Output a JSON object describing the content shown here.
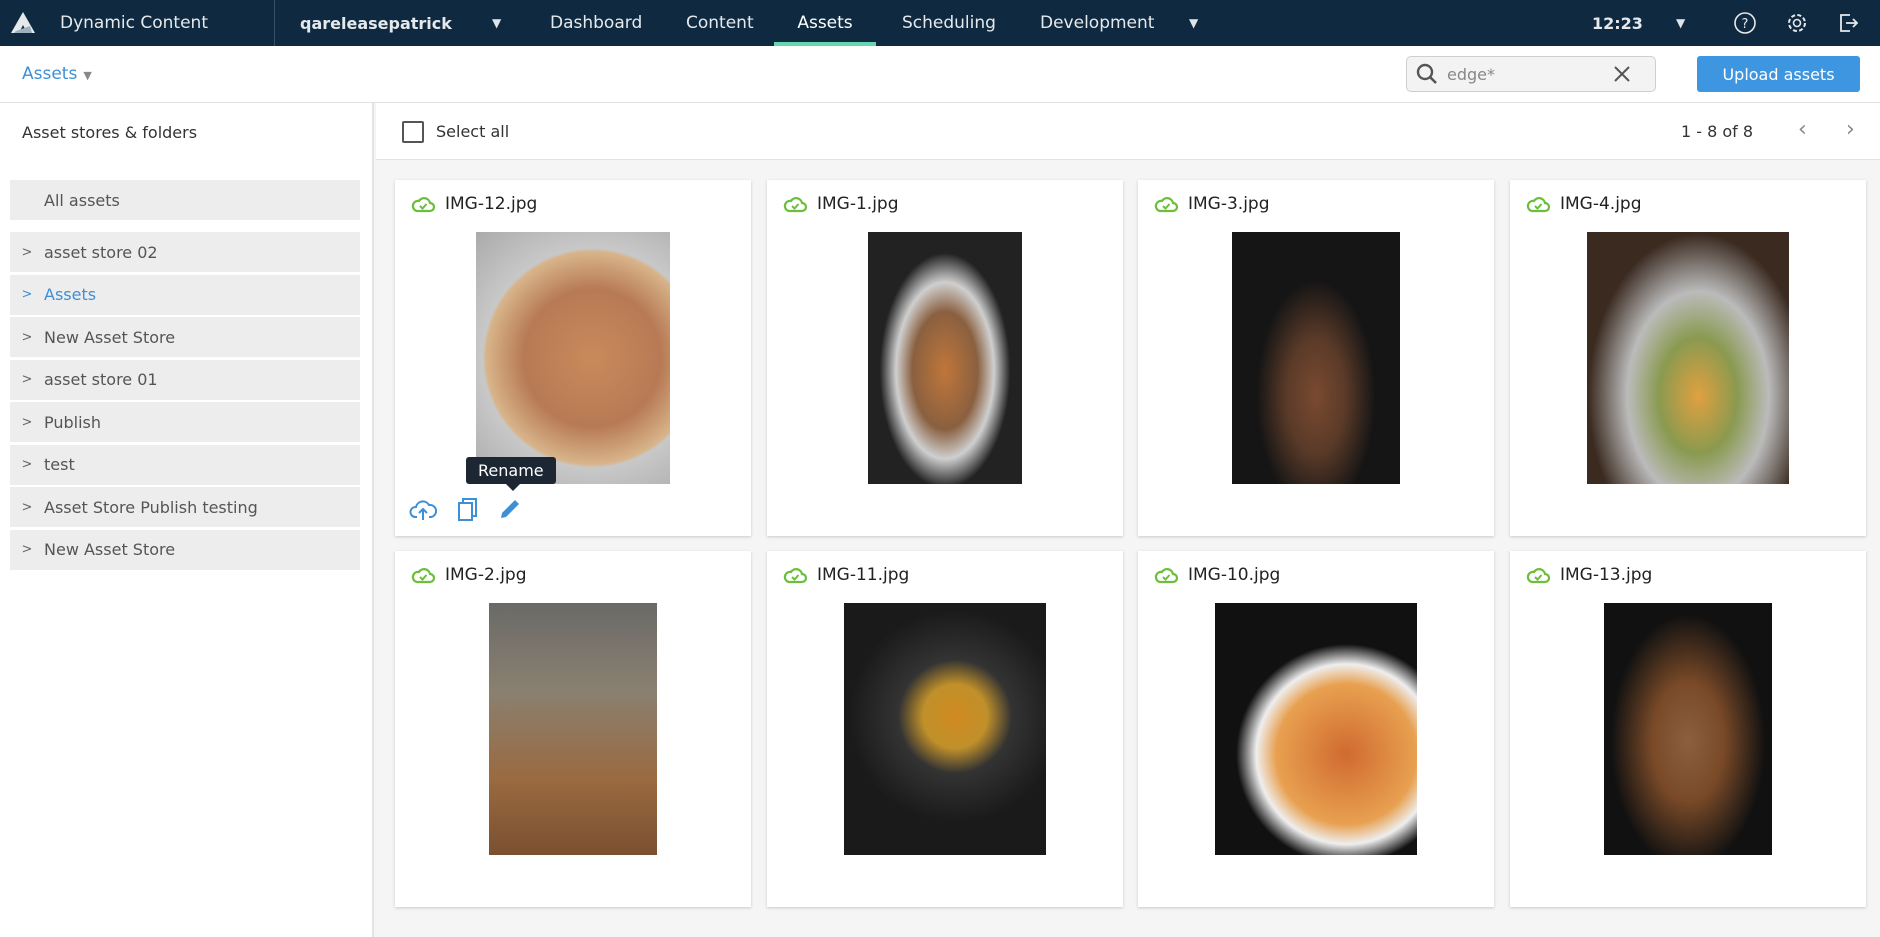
{
  "topbar": {
    "app_name": "Dynamic Content",
    "account": "qareleasepatrick",
    "nav": [
      "Dashboard",
      "Content",
      "Assets",
      "Scheduling",
      "Development"
    ],
    "active_nav": "Assets",
    "time": "12:23",
    "bg_color": "#0f2a40",
    "accent": "#65d6b0"
  },
  "subheader": {
    "breadcrumb": "Assets",
    "search_value": "edge*",
    "upload_label": "Upload assets"
  },
  "sidebar": {
    "title": "Asset stores & folders",
    "all_assets": "All assets",
    "items": [
      {
        "label": "asset store 02"
      },
      {
        "label": "Assets",
        "active": true
      },
      {
        "label": "New Asset Store"
      },
      {
        "label": "asset store 01"
      },
      {
        "label": "Publish"
      },
      {
        "label": "test"
      },
      {
        "label": "Asset Store Publish testing"
      },
      {
        "label": "New Asset Store"
      }
    ]
  },
  "toolbar": {
    "select_all": "Select all",
    "pagination": "1 - 8 of 8"
  },
  "assets": [
    {
      "name": "IMG-12.jpg"
    },
    {
      "name": "IMG-1.jpg"
    },
    {
      "name": "IMG-3.jpg"
    },
    {
      "name": "IMG-4.jpg"
    },
    {
      "name": "IMG-2.jpg"
    },
    {
      "name": "IMG-11.jpg"
    },
    {
      "name": "IMG-10.jpg"
    },
    {
      "name": "IMG-13.jpg"
    }
  ],
  "tooltip": "Rename"
}
